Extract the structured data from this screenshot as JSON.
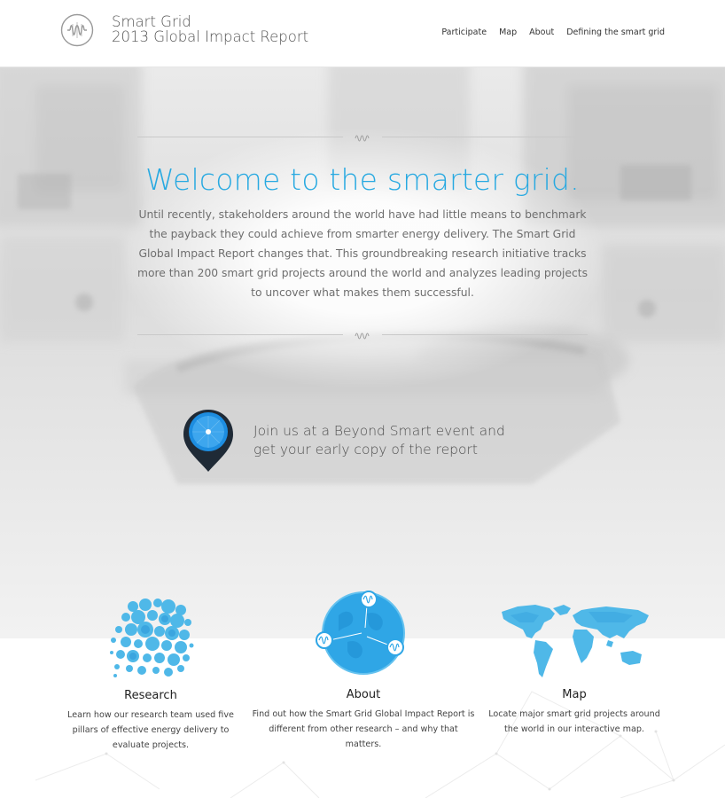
{
  "brand": {
    "line1": "Smart Grid",
    "line2": "2013 Global Impact Report"
  },
  "nav": [
    "Participate",
    "Map",
    "About",
    "Defining the smart grid"
  ],
  "hero": {
    "title": "Welcome to the smarter grid.",
    "body": "Until recently, stakeholders around the world have had little means to benchmark the payback they could achieve from smarter energy delivery. The Smart Grid Global Impact Report changes that. This groundbreaking research initiative tracks more than 200 smart grid projects around the world and analyzes leading projects to uncover what makes them successful."
  },
  "event": {
    "line1": "Join us at a Beyond Smart event and",
    "line2": "get your early copy of the report"
  },
  "features": [
    {
      "title": "Research",
      "text": "Learn how our research team used five pillars of effective energy delivery to evaluate projects."
    },
    {
      "title": "About",
      "text": "Find out how the Smart Grid Global Impact Report is different from other research – and why that matters."
    },
    {
      "title": "Map",
      "text": "Locate major smart grid projects around the world in our interactive map."
    }
  ],
  "colors": {
    "accent": "#27a9e1",
    "illustration": "#4fb8e8",
    "pin_dark": "#1f2a36"
  },
  "icons": [
    "logo-icon",
    "divider-wave-icon",
    "location-pin-icon",
    "research-bubbles-icon",
    "globe-network-icon",
    "world-map-icon"
  ]
}
